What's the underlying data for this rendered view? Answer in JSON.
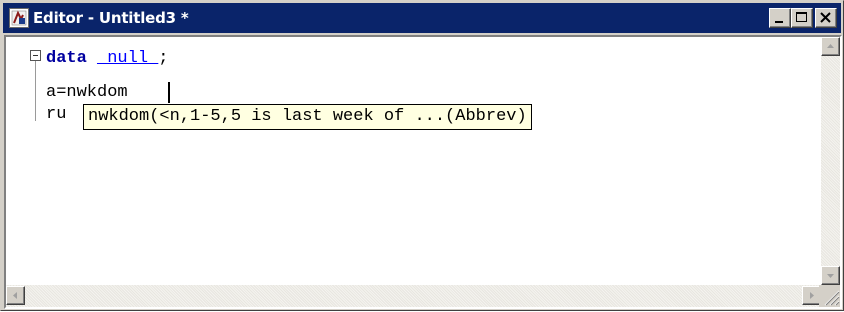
{
  "window": {
    "title": "Editor - Untitled3 *"
  },
  "editor": {
    "lines": [
      {
        "keyword": "data",
        "space": " ",
        "special": "_null_",
        "end": ";"
      },
      {
        "text": "a=nwkdom"
      },
      {
        "text": "ru"
      }
    ],
    "tooltip": "nwkdom(<n,1-5,5 is last week of ...(Abbrev)"
  },
  "colors": {
    "titlebar": "#0a246a",
    "keyword": "#0000a0",
    "special": "#0000ff",
    "tooltip_bg": "#ffffe1"
  }
}
